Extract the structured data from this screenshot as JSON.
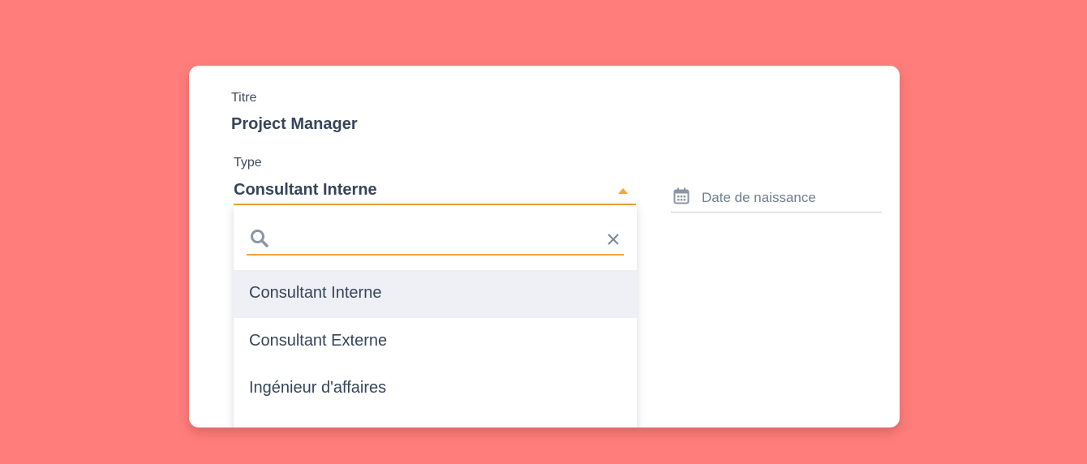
{
  "form": {
    "titre": {
      "label": "Titre",
      "value": "Project Manager"
    },
    "type": {
      "label": "Type",
      "value": "Consultant Interne"
    },
    "date": {
      "placeholder": "Date de naissance"
    }
  },
  "dropdown": {
    "search_value": "",
    "options": [
      {
        "label": "Consultant Interne",
        "selected": true
      },
      {
        "label": "Consultant Externe",
        "selected": false
      },
      {
        "label": "Ingénieur d'affaires",
        "selected": false
      }
    ]
  },
  "colors": {
    "background": "#ff7e7c",
    "accent": "#f3a43b",
    "text": "#364559",
    "selected_row": "#eff0f5"
  },
  "icons": [
    "search-icon",
    "clear-icon",
    "calendar-icon",
    "caret-up-icon"
  ]
}
